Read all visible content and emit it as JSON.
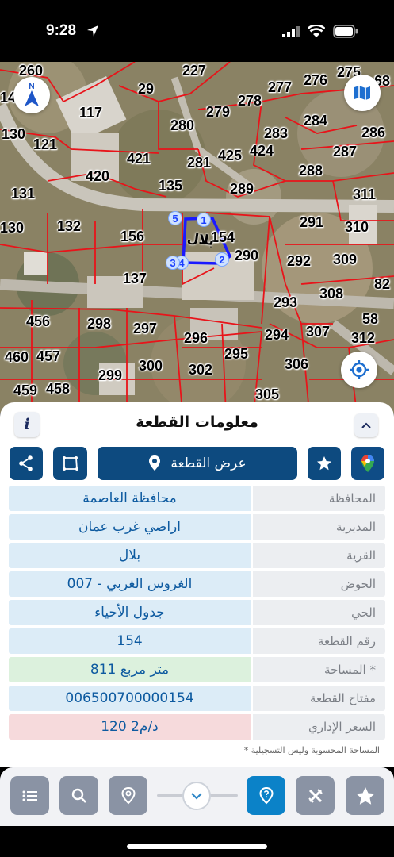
{
  "status": {
    "time": "9:28"
  },
  "map": {
    "parcels": [
      {
        "n": "260"
      },
      {
        "n": "14"
      },
      {
        "n": "130"
      },
      {
        "n": "121"
      },
      {
        "n": "131"
      },
      {
        "n": "130"
      },
      {
        "n": "117"
      },
      {
        "n": "29"
      },
      {
        "n": "227"
      },
      {
        "n": "277"
      },
      {
        "n": "276"
      },
      {
        "n": "275"
      },
      {
        "n": "68"
      },
      {
        "n": "278"
      },
      {
        "n": "279"
      },
      {
        "n": "280"
      },
      {
        "n": "283"
      },
      {
        "n": "284"
      },
      {
        "n": "286"
      },
      {
        "n": "287"
      },
      {
        "n": "424"
      },
      {
        "n": "425"
      },
      {
        "n": "281"
      },
      {
        "n": "421"
      },
      {
        "n": "420"
      },
      {
        "n": "135"
      },
      {
        "n": "289"
      },
      {
        "n": "288"
      },
      {
        "n": "311"
      },
      {
        "n": "291"
      },
      {
        "n": "310"
      },
      {
        "n": "132"
      },
      {
        "n": "156"
      },
      {
        "n": "154"
      },
      {
        "n": "290"
      },
      {
        "n": "292"
      },
      {
        "n": "309"
      },
      {
        "n": "137"
      },
      {
        "n": "308"
      },
      {
        "n": "82"
      },
      {
        "n": "293"
      },
      {
        "n": "456"
      },
      {
        "n": "298"
      },
      {
        "n": "297"
      },
      {
        "n": "296"
      },
      {
        "n": "294"
      },
      {
        "n": "307"
      },
      {
        "n": "58"
      },
      {
        "n": "312"
      },
      {
        "n": "460"
      },
      {
        "n": "457"
      },
      {
        "n": "295"
      },
      {
        "n": "306"
      },
      {
        "n": "299"
      },
      {
        "n": "300"
      },
      {
        "n": "302"
      },
      {
        "n": "459"
      },
      {
        "n": "458"
      },
      {
        "n": "305"
      }
    ],
    "vertices": [
      "1",
      "2",
      "4",
      "3",
      "5"
    ],
    "owner_label": "بلال",
    "north_label": "N"
  },
  "sheet": {
    "title": "معلومات القطعة",
    "info_label": "i",
    "show_parcel_label": "عرض القطعة",
    "rows": [
      {
        "label": "المحافظة",
        "value": "محافظة العاصمة"
      },
      {
        "label": "المديرية",
        "value": "اراضي غرب عمان"
      },
      {
        "label": "القرية",
        "value": "بلال"
      },
      {
        "label": "الحوض",
        "value": "الغروس الغربي - 007"
      },
      {
        "label": "الحي",
        "value": "جدول الأحياء"
      },
      {
        "label": "رقم القطعة",
        "value": "154"
      },
      {
        "label": "المساحة *",
        "value": "811   متر مربع"
      },
      {
        "label": "مفتاح القطعة",
        "value": "006500700000154"
      },
      {
        "label": "السعر الإداري",
        "value": "120 د/م2"
      }
    ],
    "footnote": "* المساحة المحسوبة وليس التسجيلية"
  },
  "colors": {
    "accent": "#0d4a7f",
    "toolbar_primary": "#0b82c8",
    "toolbar_gray": "#8a93a4",
    "parcel_border": "#e8141a",
    "selected_parcel": "#1a1aff"
  },
  "icons": [
    "navigation-arrow-icon",
    "signal-icon",
    "wifi-icon",
    "battery-icon",
    "compass-icon",
    "map-layers-icon",
    "locate-icon",
    "chevron-up-icon",
    "share-icon",
    "polygon-icon",
    "location-pin-icon",
    "star-icon",
    "google-maps-icon",
    "list-icon",
    "search-icon",
    "pin-search-icon",
    "chevron-down-icon",
    "help-pin-icon",
    "tools-icon"
  ]
}
